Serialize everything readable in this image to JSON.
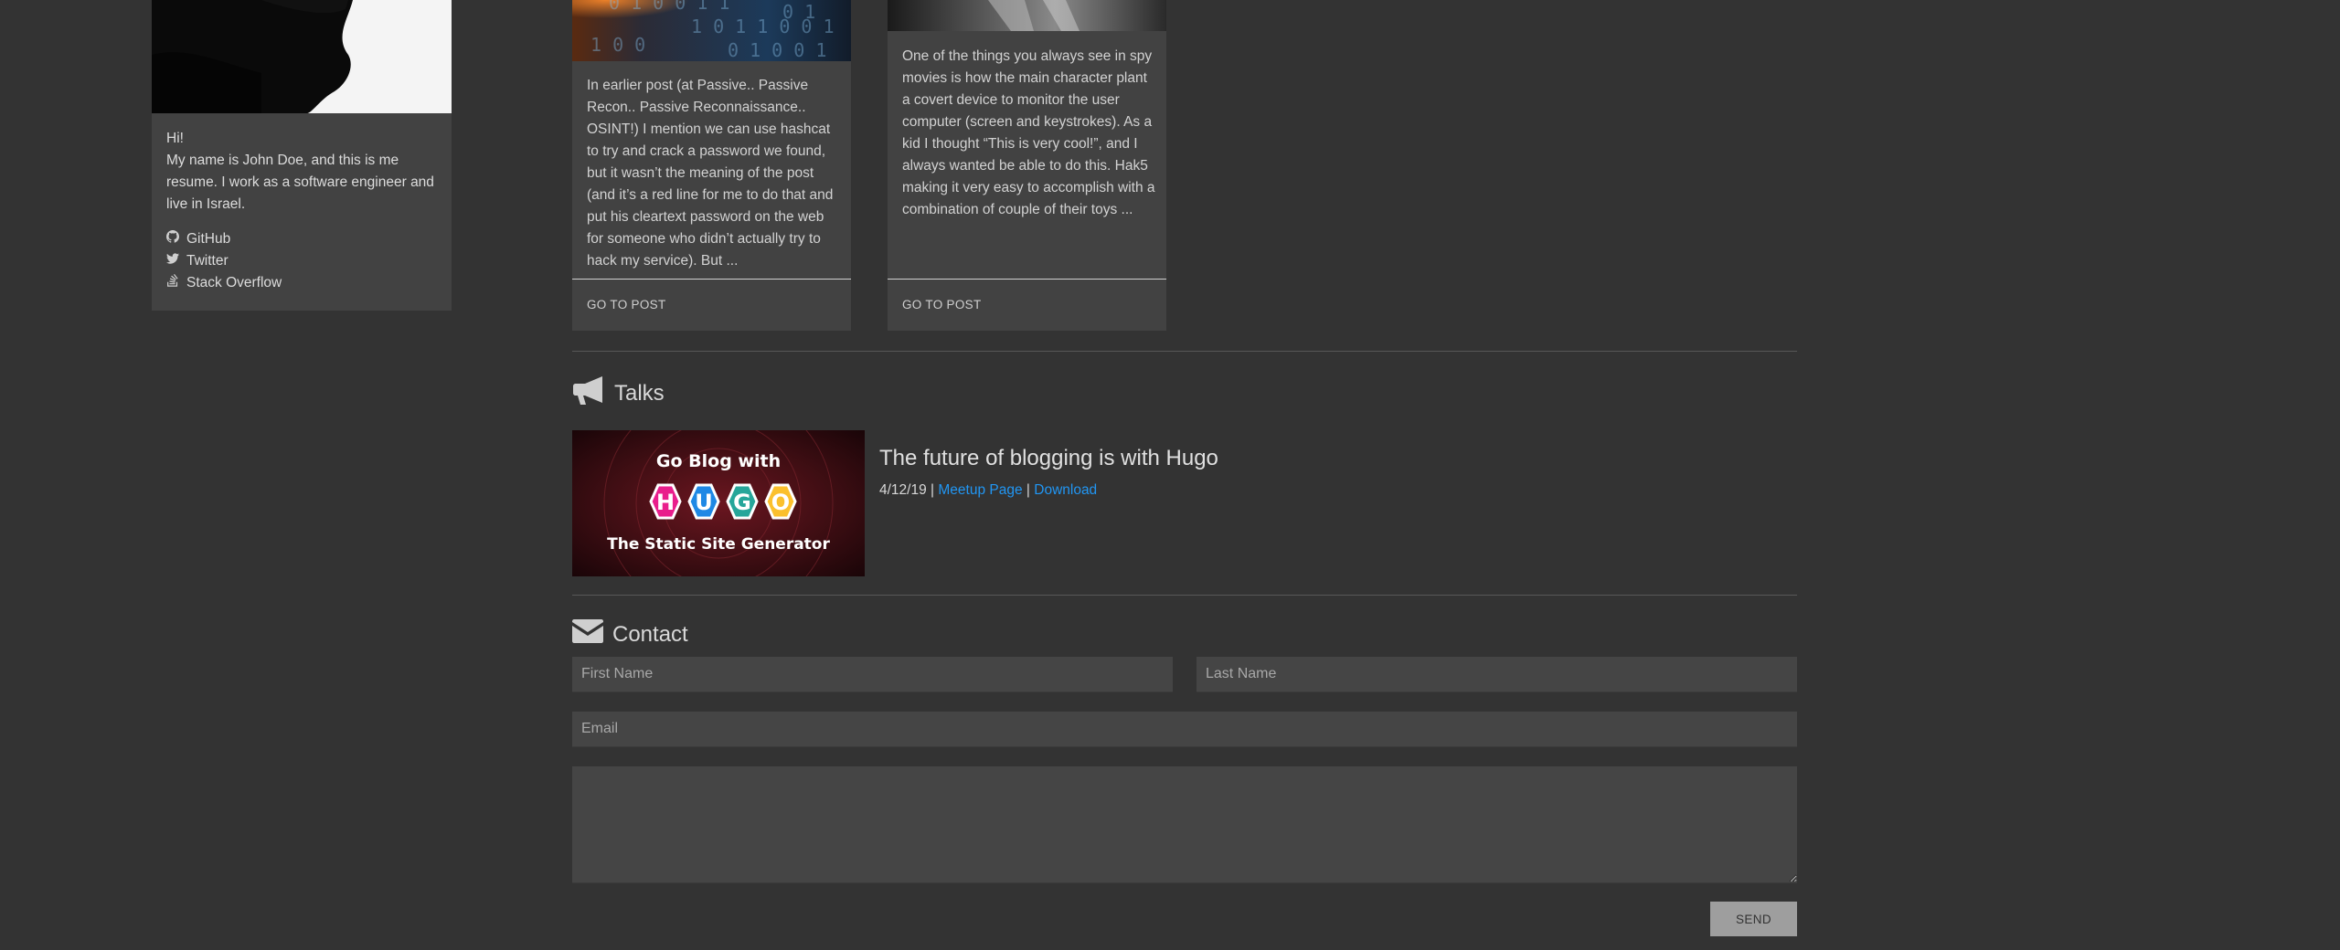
{
  "profile": {
    "greeting": "Hi!",
    "bio": "My name is John Doe, and this is me resume. I work as a software engineer and live in Israel.",
    "links": [
      {
        "label": "GitHub",
        "icon": "github-icon"
      },
      {
        "label": "Twitter",
        "icon": "twitter-icon"
      },
      {
        "label": "Stack Overflow",
        "icon": "stack-overflow-icon"
      }
    ]
  },
  "posts": [
    {
      "excerpt": "In earlier post (at Passive.. Passive Recon.. Passive Reconnaissance.. OSINT!) I mention we can use hashcat to try and crack a password we found, but it wasn’t the meaning of the post (and it’s a red line for me to do that and put his cleartext password on the web for someone who didn’t actually try to hack my service). But ...",
      "link_label": "GO TO POST"
    },
    {
      "excerpt": "One of the things you always see in spy movies is how the main character plant a covert device to monitor the user computer (screen and keystrokes). As a kid I thought “This is very cool!”, and I always wanted be able to do this. Hak5 making it very easy to accomplish with a combination of couple of their toys ...",
      "link_label": "GO TO POST"
    }
  ],
  "talks": {
    "heading": "Talks",
    "items": [
      {
        "banner_line1": "Go Blog with",
        "banner_letters": [
          "H",
          "U",
          "G",
          "O"
        ],
        "banner_line2": "The Static Site Generator",
        "title": "The future of blogging is with Hugo",
        "date": "4/12/19",
        "separator": "|",
        "meetup_label": "Meetup Page",
        "download_label": "Download"
      }
    ]
  },
  "contact": {
    "heading": "Contact",
    "first_name_placeholder": "First Name",
    "last_name_placeholder": "Last Name",
    "email_placeholder": "Email",
    "message_placeholder": "",
    "send_label": "SEND"
  },
  "colors": {
    "background": "#333333",
    "card": "#424242",
    "link": "#2196f3",
    "hugo_letters": [
      "#e91e8c",
      "#1e88e5",
      "#26a69a",
      "#fbc02d"
    ]
  }
}
